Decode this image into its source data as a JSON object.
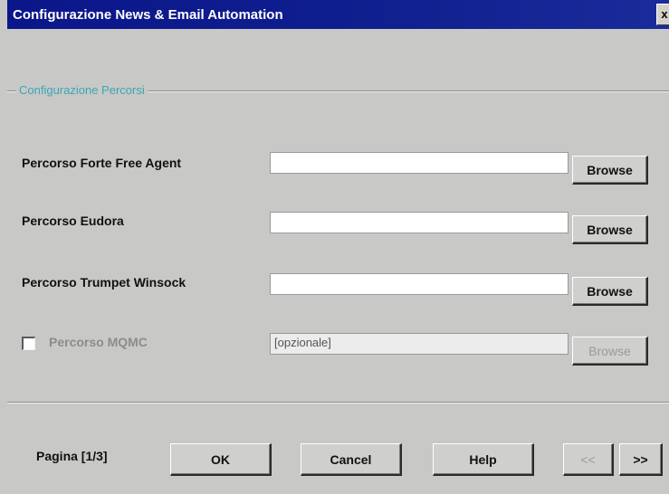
{
  "window": {
    "title": "Configurazione News & Email Automation",
    "close_label": "x"
  },
  "group": {
    "label": "Configurazione Percorsi"
  },
  "rows": [
    {
      "label": "Percorso Forte Free Agent",
      "value": "",
      "browse_label": "Browse",
      "enabled": true
    },
    {
      "label": "Percorso Eudora",
      "value": "",
      "browse_label": "Browse",
      "enabled": true
    },
    {
      "label": "Percorso Trumpet Winsock",
      "value": "",
      "browse_label": "Browse",
      "enabled": true
    },
    {
      "label": "Percorso MQMC",
      "value": "[opzionale]",
      "browse_label": "Browse",
      "enabled": false,
      "checked": false
    }
  ],
  "footer": {
    "page_label": "Pagina [1/3]",
    "ok_label": "OK",
    "cancel_label": "Cancel",
    "help_label": "Help",
    "prev_label": "<<",
    "next_label": ">>"
  },
  "colors": {
    "titlebar": "#0b168a",
    "group_label": "#3aa7b5",
    "dialog_bg": "#c8c8c6"
  }
}
